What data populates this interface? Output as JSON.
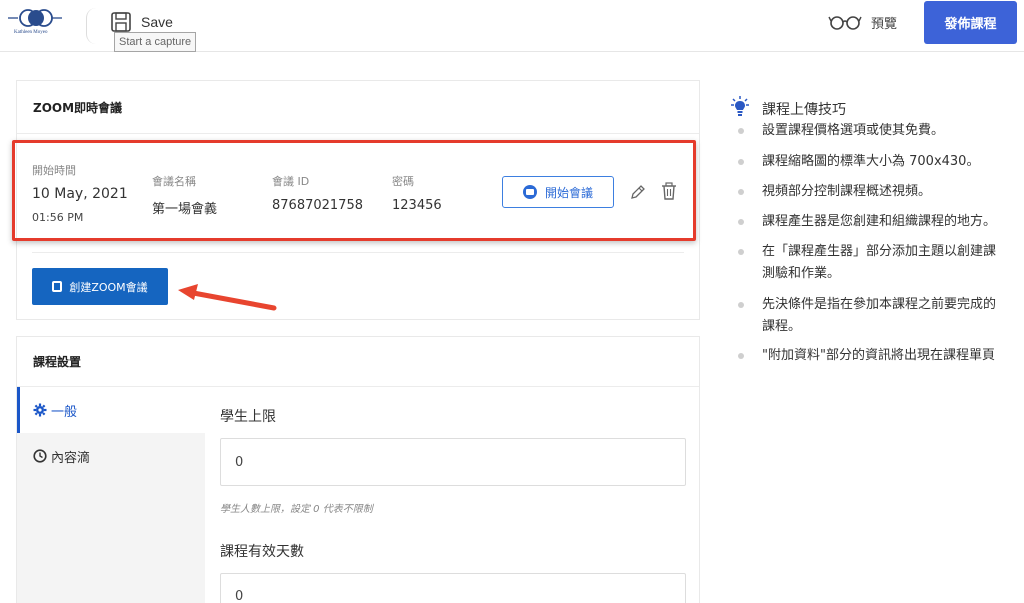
{
  "brand": {
    "logo_text": "Kathleen Moyeo"
  },
  "toolbar": {
    "save_label": "Save",
    "tooltip": "Start a capture",
    "preview_label": "預覽",
    "publish_label": "發佈課程"
  },
  "zoom": {
    "title": "ZOOM即時會議",
    "meeting": {
      "start_time_label": "開始時間",
      "date": "10 May, 2021",
      "time": "01:56 PM",
      "name_label": "會議名稱",
      "name": "第一場會義",
      "id_label": "會議 ID",
      "id": "87687021758",
      "password_label": "密碼",
      "password": "123456",
      "start_button": "開始會議"
    },
    "create_button": "創建ZOOM會議"
  },
  "settings": {
    "title": "課程設置",
    "tabs": [
      {
        "label": "一般",
        "icon": "gear-icon"
      },
      {
        "label": "內容滴",
        "icon": "clock-icon"
      }
    ],
    "fields": [
      {
        "label": "學生上限",
        "value": "0",
        "hint": "學生人數上限，設定 0 代表不限制"
      },
      {
        "label": "課程有效天數",
        "value": "0"
      }
    ]
  },
  "tips": {
    "title": "課程上傳技巧",
    "items": [
      "設置課程價格選項或使其免費。",
      "課程縮略圖的標準大小為 700x430。",
      "視頻部分控制課程概述視頻。",
      "課程產生器是您創建和組織課程的地方。",
      "在「課程產生器」部分添加主題以創建課",
      "測驗和作業。",
      "先決條件是指在參加本課程之前要完成的",
      "課程。",
      "\"附加資料\"部分的資訊將出現在課程單頁"
    ]
  },
  "colors": {
    "accent": "#3d63d8",
    "zoom_blue": "#1565c0",
    "highlight_red": "#e53b2c"
  }
}
